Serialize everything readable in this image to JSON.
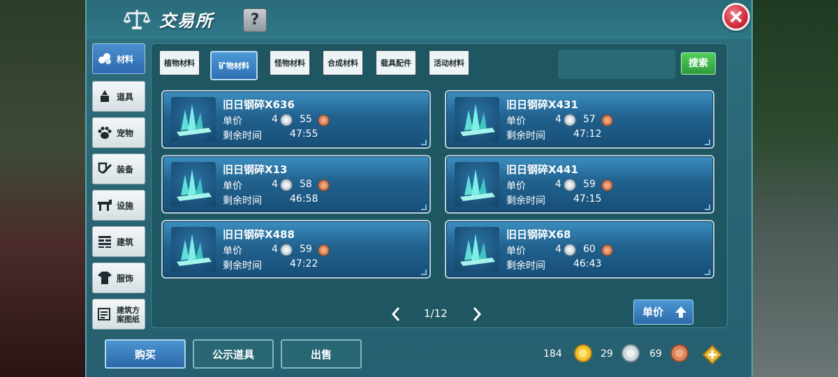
{
  "header": {
    "title": "交易所",
    "help_label": "?"
  },
  "sidebar": {
    "items": [
      {
        "label": "材料",
        "icon": "materials-icon"
      },
      {
        "label": "道具",
        "icon": "item-icon"
      },
      {
        "label": "宠物",
        "icon": "paw-icon"
      },
      {
        "label": "装备",
        "icon": "equipment-icon"
      },
      {
        "label": "设施",
        "icon": "facility-icon"
      },
      {
        "label": "建筑",
        "icon": "brick-icon"
      },
      {
        "label": "服饰",
        "icon": "clothing-icon"
      },
      {
        "label": "建筑方案图纸",
        "icon": "blueprint-icon"
      }
    ]
  },
  "tabs": [
    {
      "label": "植物材料"
    },
    {
      "label": "矿物材料"
    },
    {
      "label": "怪物材料"
    },
    {
      "label": "合成材料"
    },
    {
      "label": "载具配件"
    },
    {
      "label": "活动材料"
    }
  ],
  "search": {
    "button_label": "搜索",
    "value": ""
  },
  "listing_labels": {
    "unit_price": "单价",
    "remaining_time": "剩余时间"
  },
  "listings": [
    {
      "name": "旧日钢碎X636",
      "silver": "4",
      "copper": "55",
      "time": "47:55"
    },
    {
      "name": "旧日钢碎X431",
      "silver": "4",
      "copper": "57",
      "time": "47:12"
    },
    {
      "name": "旧日钢碎X13",
      "silver": "4",
      "copper": "58",
      "time": "46:58"
    },
    {
      "name": "旧日钢碎X441",
      "silver": "4",
      "copper": "59",
      "time": "47:15"
    },
    {
      "name": "旧日钢碎X488",
      "silver": "4",
      "copper": "59",
      "time": "47:22"
    },
    {
      "name": "旧日钢碎X68",
      "silver": "4",
      "copper": "60",
      "time": "46:43"
    }
  ],
  "pager": {
    "text": "1/12"
  },
  "sort": {
    "label": "单价"
  },
  "bottom_buttons": {
    "buy": "购买",
    "public": "公示道具",
    "sell": "出售"
  },
  "currency": {
    "gold": "184",
    "silver": "29",
    "copper": "69"
  },
  "colors": {
    "accent_blue": "#2f6fb4",
    "search_green": "#2f9a3c",
    "panel_teal": "#2b6675",
    "close_red": "#d6303f"
  }
}
